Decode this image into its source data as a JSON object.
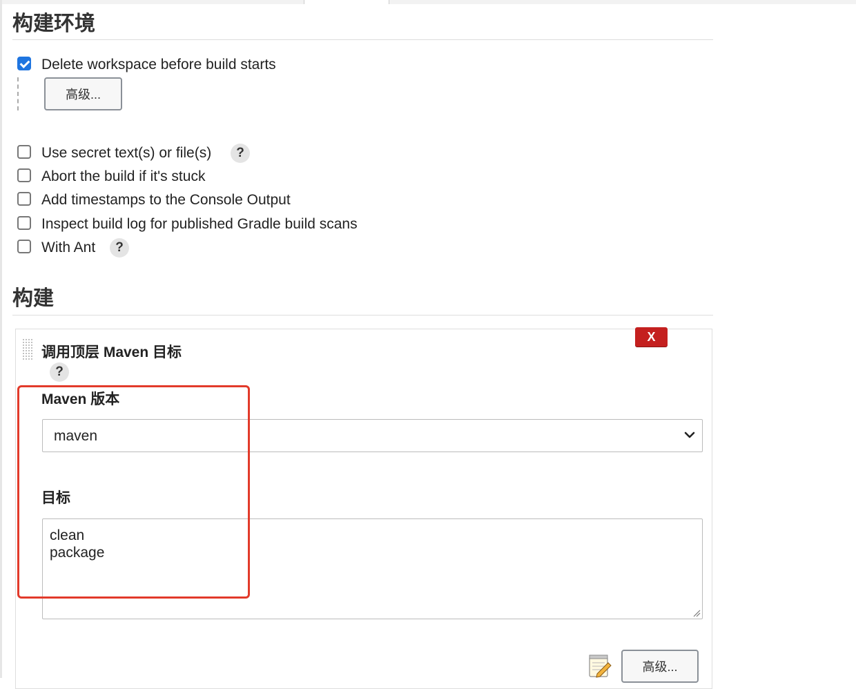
{
  "build_env": {
    "title": "构建环境",
    "delete_workspace": {
      "label": "Delete workspace before build starts",
      "checked": true
    },
    "advanced_button": "高级...",
    "options": [
      {
        "label": "Use secret text(s) or file(s)",
        "checked": false,
        "help": "?"
      },
      {
        "label": "Abort the build if it's stuck",
        "checked": false
      },
      {
        "label": "Add timestamps to the Console Output",
        "checked": false
      },
      {
        "label": "Inspect build log for published Gradle build scans",
        "checked": false
      },
      {
        "label": "With Ant",
        "checked": false,
        "help": "?"
      }
    ]
  },
  "build": {
    "title": "构建",
    "step": {
      "title": "调用顶层 Maven 目标",
      "help": "?",
      "delete_label": "X",
      "maven_version": {
        "label": "Maven 版本",
        "value": "maven"
      },
      "goals": {
        "label": "目标",
        "lines": [
          "clean",
          "package"
        ]
      },
      "advanced_button": "高级..."
    }
  },
  "colors": {
    "accent": "#1f75e0",
    "delete": "#c4201f",
    "highlight": "#e23a2a"
  },
  "icons": [
    "help-icon",
    "chevron-down-icon",
    "notepad-icon",
    "drag-handle-icon",
    "resize-grip-icon"
  ]
}
